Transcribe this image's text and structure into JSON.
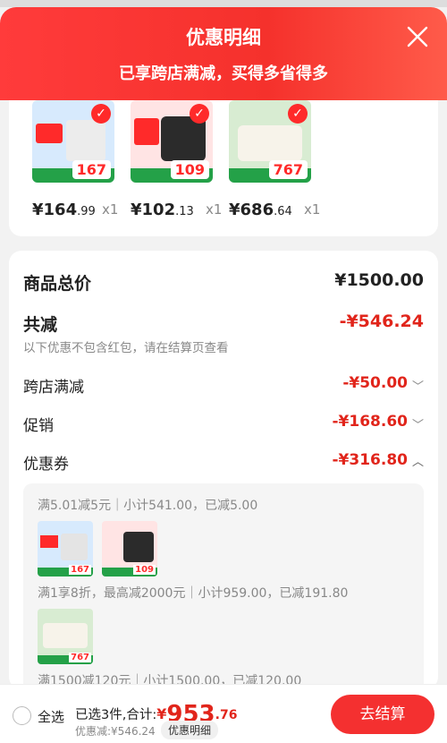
{
  "header": {
    "title": "优惠明细",
    "subtitle": "已享跨店满减，买得多省得多"
  },
  "products": [
    {
      "price_main": "¥164",
      "price_cents": ".99",
      "qty": "x1",
      "thumb_price": "167",
      "colors": {
        "bg": "#d7eafd",
        "badge": "#ff2a2a"
      }
    },
    {
      "price_main": "¥102",
      "price_cents": ".13",
      "qty": "x1",
      "thumb_price": "109",
      "colors": {
        "bg": "#ffe4e4",
        "badge": "#ff2a2a"
      }
    },
    {
      "price_main": "¥686",
      "price_cents": ".64",
      "qty": "x1",
      "thumb_price": "767",
      "colors": {
        "bg": "#d8ecd2",
        "badge": "#ff2a2a"
      }
    }
  ],
  "summary_rows": {
    "total_label": "商品总价",
    "total_value": "¥1500.00",
    "reduce_label": "共减",
    "reduce_value": "-¥546.24",
    "note": "以下优惠不包含红包，请在结算页查看",
    "cross_label": "跨店满减",
    "cross_value": "-¥50.00",
    "promo_label": "促销",
    "promo_value": "-¥168.60",
    "coupon_label": "优惠券",
    "coupon_value": "-¥316.80"
  },
  "coupon_details": {
    "line1": "满5.01减5元｜小计541.00，已减5.00",
    "line2": "满1享8折，最高减2000元｜小计959.00，已减191.80",
    "line3": "满1500减120元｜小计1500.00，已减120.00",
    "thumb_prices": [
      "167",
      "109",
      "767"
    ]
  },
  "bottom_bar": {
    "select_all": "全选",
    "selected_text": "已选3件,合计:",
    "total_symbol": "¥",
    "total_main": "953",
    "total_cents": ".76",
    "discount_text": "优惠减:¥546.24",
    "detail_tag": "优惠明细",
    "checkout": "去结算"
  },
  "accent_color": "#e1251b"
}
